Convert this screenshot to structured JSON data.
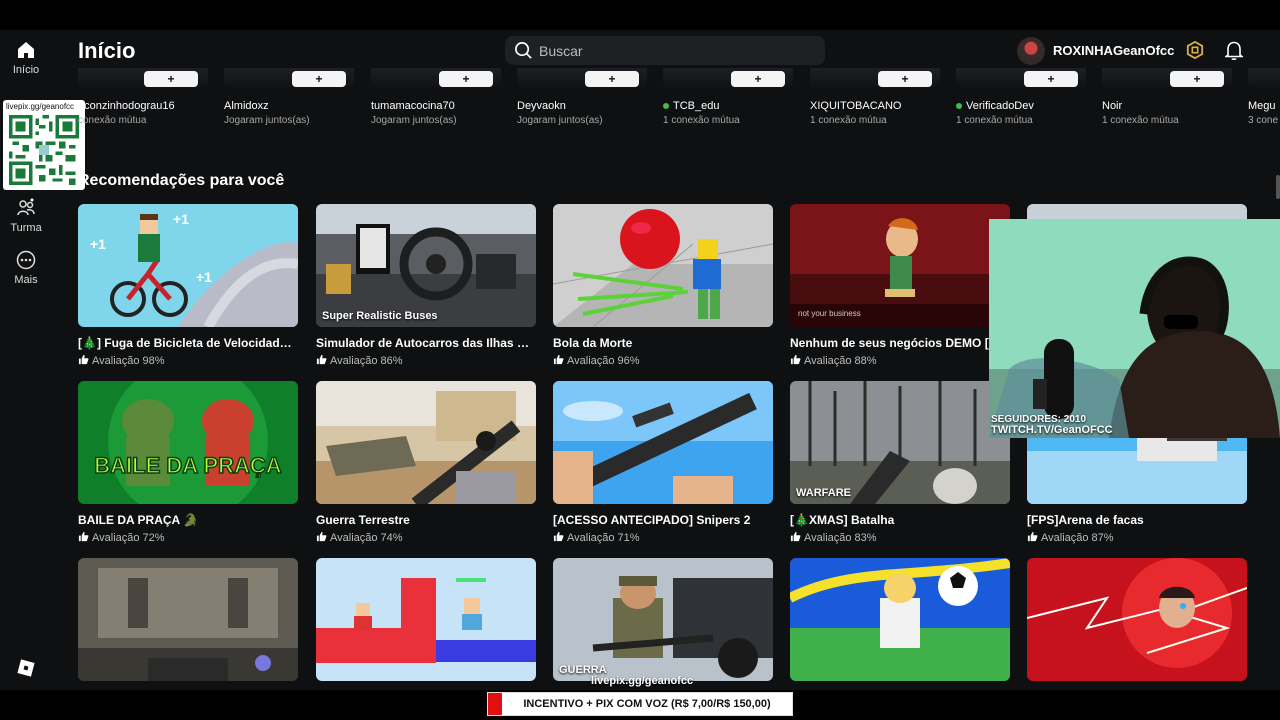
{
  "nav": {
    "home_label": "Início",
    "team_label": "Turma",
    "more_label": "Mais"
  },
  "header": {
    "title": "Início",
    "search_placeholder": "Buscar",
    "username": "ROXINHAGeanOfcc"
  },
  "qr": {
    "label": "livepix.gg/geanofcc"
  },
  "friends": [
    {
      "name": "aconzinhodograu16",
      "sub": "conexão mútua",
      "online": false
    },
    {
      "name": "Almidoxz",
      "sub": "Jogaram juntos(as)",
      "online": false
    },
    {
      "name": "tumamacocina70",
      "sub": "Jogaram juntos(as)",
      "online": false
    },
    {
      "name": "Deyvaokn",
      "sub": "Jogaram juntos(as)",
      "online": false
    },
    {
      "name": "TCB_edu",
      "sub": "1 conexão mútua",
      "online": true
    },
    {
      "name": "XIQUITOBACANO",
      "sub": "1 conexão mútua",
      "online": false
    },
    {
      "name": "VerificadoDev",
      "sub": "1 conexão mútua",
      "online": true
    },
    {
      "name": "Noir",
      "sub": "1 conexão mútua",
      "online": false
    },
    {
      "name": "Megu",
      "sub": "3 cone",
      "online": false
    }
  ],
  "add_friend_symbol": "+",
  "section_title": "Recomendações para você",
  "games": [
    {
      "name": "[🎄] Fuga de Bicicleta de Velocidade +1",
      "rating": "Avaliação 98%",
      "thumb_label": ""
    },
    {
      "name": "Simulador de Autocarros das Ilhas Ens...",
      "rating": "Avaliação 86%",
      "thumb_label": "Super Realistic Buses"
    },
    {
      "name": "Bola da Morte",
      "rating": "Avaliação 96%",
      "thumb_label": ""
    },
    {
      "name": "Nenhum de seus negócios DEMO [NÃ",
      "rating": "Avaliação 88%",
      "thumb_label": ""
    },
    {
      "name": "",
      "rating": "",
      "thumb_label": ""
    },
    {
      "name": "BAILE DA PRAÇA 🐊",
      "rating": "Avaliação 72%",
      "thumb_label": ""
    },
    {
      "name": "Guerra Terrestre",
      "rating": "Avaliação 74%",
      "thumb_label": ""
    },
    {
      "name": "[ACESSO ANTECIPADO] Snipers 2",
      "rating": "Avaliação 71%",
      "thumb_label": ""
    },
    {
      "name": "[🎄XMAS] Batalha",
      "rating": "Avaliação 83%",
      "thumb_label": "WARFARE"
    },
    {
      "name": "[FPS]Arena de facas",
      "rating": "Avaliação 87%",
      "thumb_label": ""
    },
    {
      "name": "",
      "rating": "",
      "thumb_label": ""
    },
    {
      "name": "",
      "rating": "",
      "thumb_label": ""
    },
    {
      "name": "",
      "rating": "",
      "thumb_label": "GUERRA"
    },
    {
      "name": "",
      "rating": "",
      "thumb_label": ""
    },
    {
      "name": "",
      "rating": "",
      "thumb_label": ""
    }
  ],
  "baile_text": "BAILE DA PRAÇA",
  "webcam": {
    "line1": "SEGUIDORES: 2010",
    "line2": "TWITCH.TV/GeanOFCC"
  },
  "overlay": {
    "livepix": "livepix.gg/geanofcc",
    "donation": "INCENTIVO + PIX COM VOZ (R$ 7,00/R$ 150,00)"
  },
  "colors": {
    "background": "#0f1011",
    "search_bg": "#1e2024",
    "donation_red": "#e01010",
    "online_green": "#3fbf4a"
  }
}
